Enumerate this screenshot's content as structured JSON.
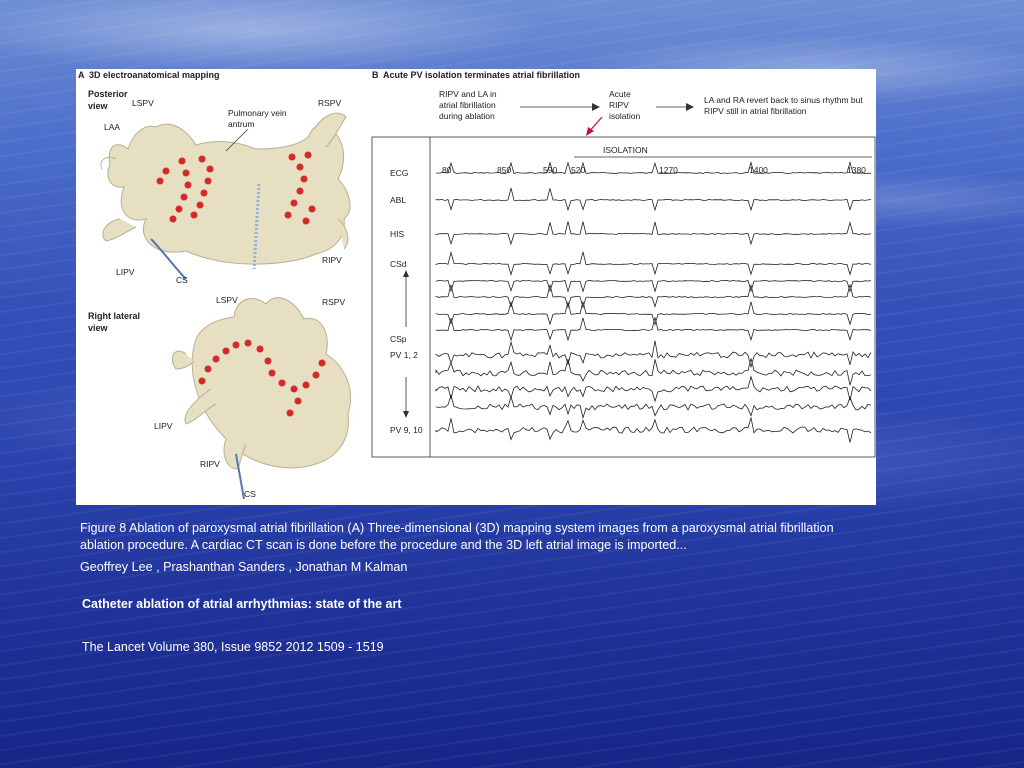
{
  "panel_a": {
    "letter": "A",
    "title": "3D electroanatomical mapping",
    "posterior_view_line1": "Posterior",
    "posterior_view_line2": "view",
    "lspv_top": "LSPV",
    "laa": "LAA",
    "pv_antrum_line1": "Pulmonary vein",
    "pv_antrum_line2": "antrum",
    "rspv_top": "RSPV",
    "lipv_top": "LIPV",
    "cs_top": "CS",
    "ripv_top": "RIPV",
    "right_lateral_line1": "Right lateral",
    "right_lateral_line2": "view",
    "lspv_bottom": "LSPV",
    "rspv_bottom": "RSPV",
    "lipv_bottom": "LIPV",
    "ripv_bottom": "RIPV",
    "cs_bottom": "CS"
  },
  "panel_b": {
    "letter": "B",
    "title": "Acute PV isolation terminates atrial fibrillation",
    "note1_line1": "RIPV and LA in",
    "note1_line2": "atrial fibrillation",
    "note1_line3": "during ablation",
    "note2_line1": "Acute",
    "note2_line2": "RIPV",
    "note2_line3": "isolation",
    "note3_line1": "LA and RA revert back to sinus rhythm but",
    "note3_line2": "RIPV still in atrial fibrillation",
    "isolation": "ISOLATION",
    "channels": [
      "ECG",
      "ABL",
      "HIS",
      "CSd",
      "CSp",
      "PV 1, 2",
      "PV 9, 10"
    ],
    "intervals": [
      "80",
      "850",
      "590",
      "520",
      "1270",
      "1400",
      "1380"
    ]
  },
  "caption": "Figure 8   Ablation of paroxysmal atrial fibrillation  (A) Three-dimensional (3D) mapping system images from a paroxysmal atrial fibrillation ablation procedure. A cardiac CT scan is done before the procedure and the 3D left atrial image is imported...",
  "authors": "Geoffrey  Lee , Prashanthan  Sanders , Jonathan M  Kalman",
  "article_title": "Catheter ablation of atrial arrhythmias: state of the art",
  "journal": "The Lancet Volume 380, Issue 9852 2012 1509 - 1519",
  "colors": {
    "ablation_points": "#d42a2a",
    "anatomy": "#e6dfc2",
    "arrow": "#c0143c"
  }
}
